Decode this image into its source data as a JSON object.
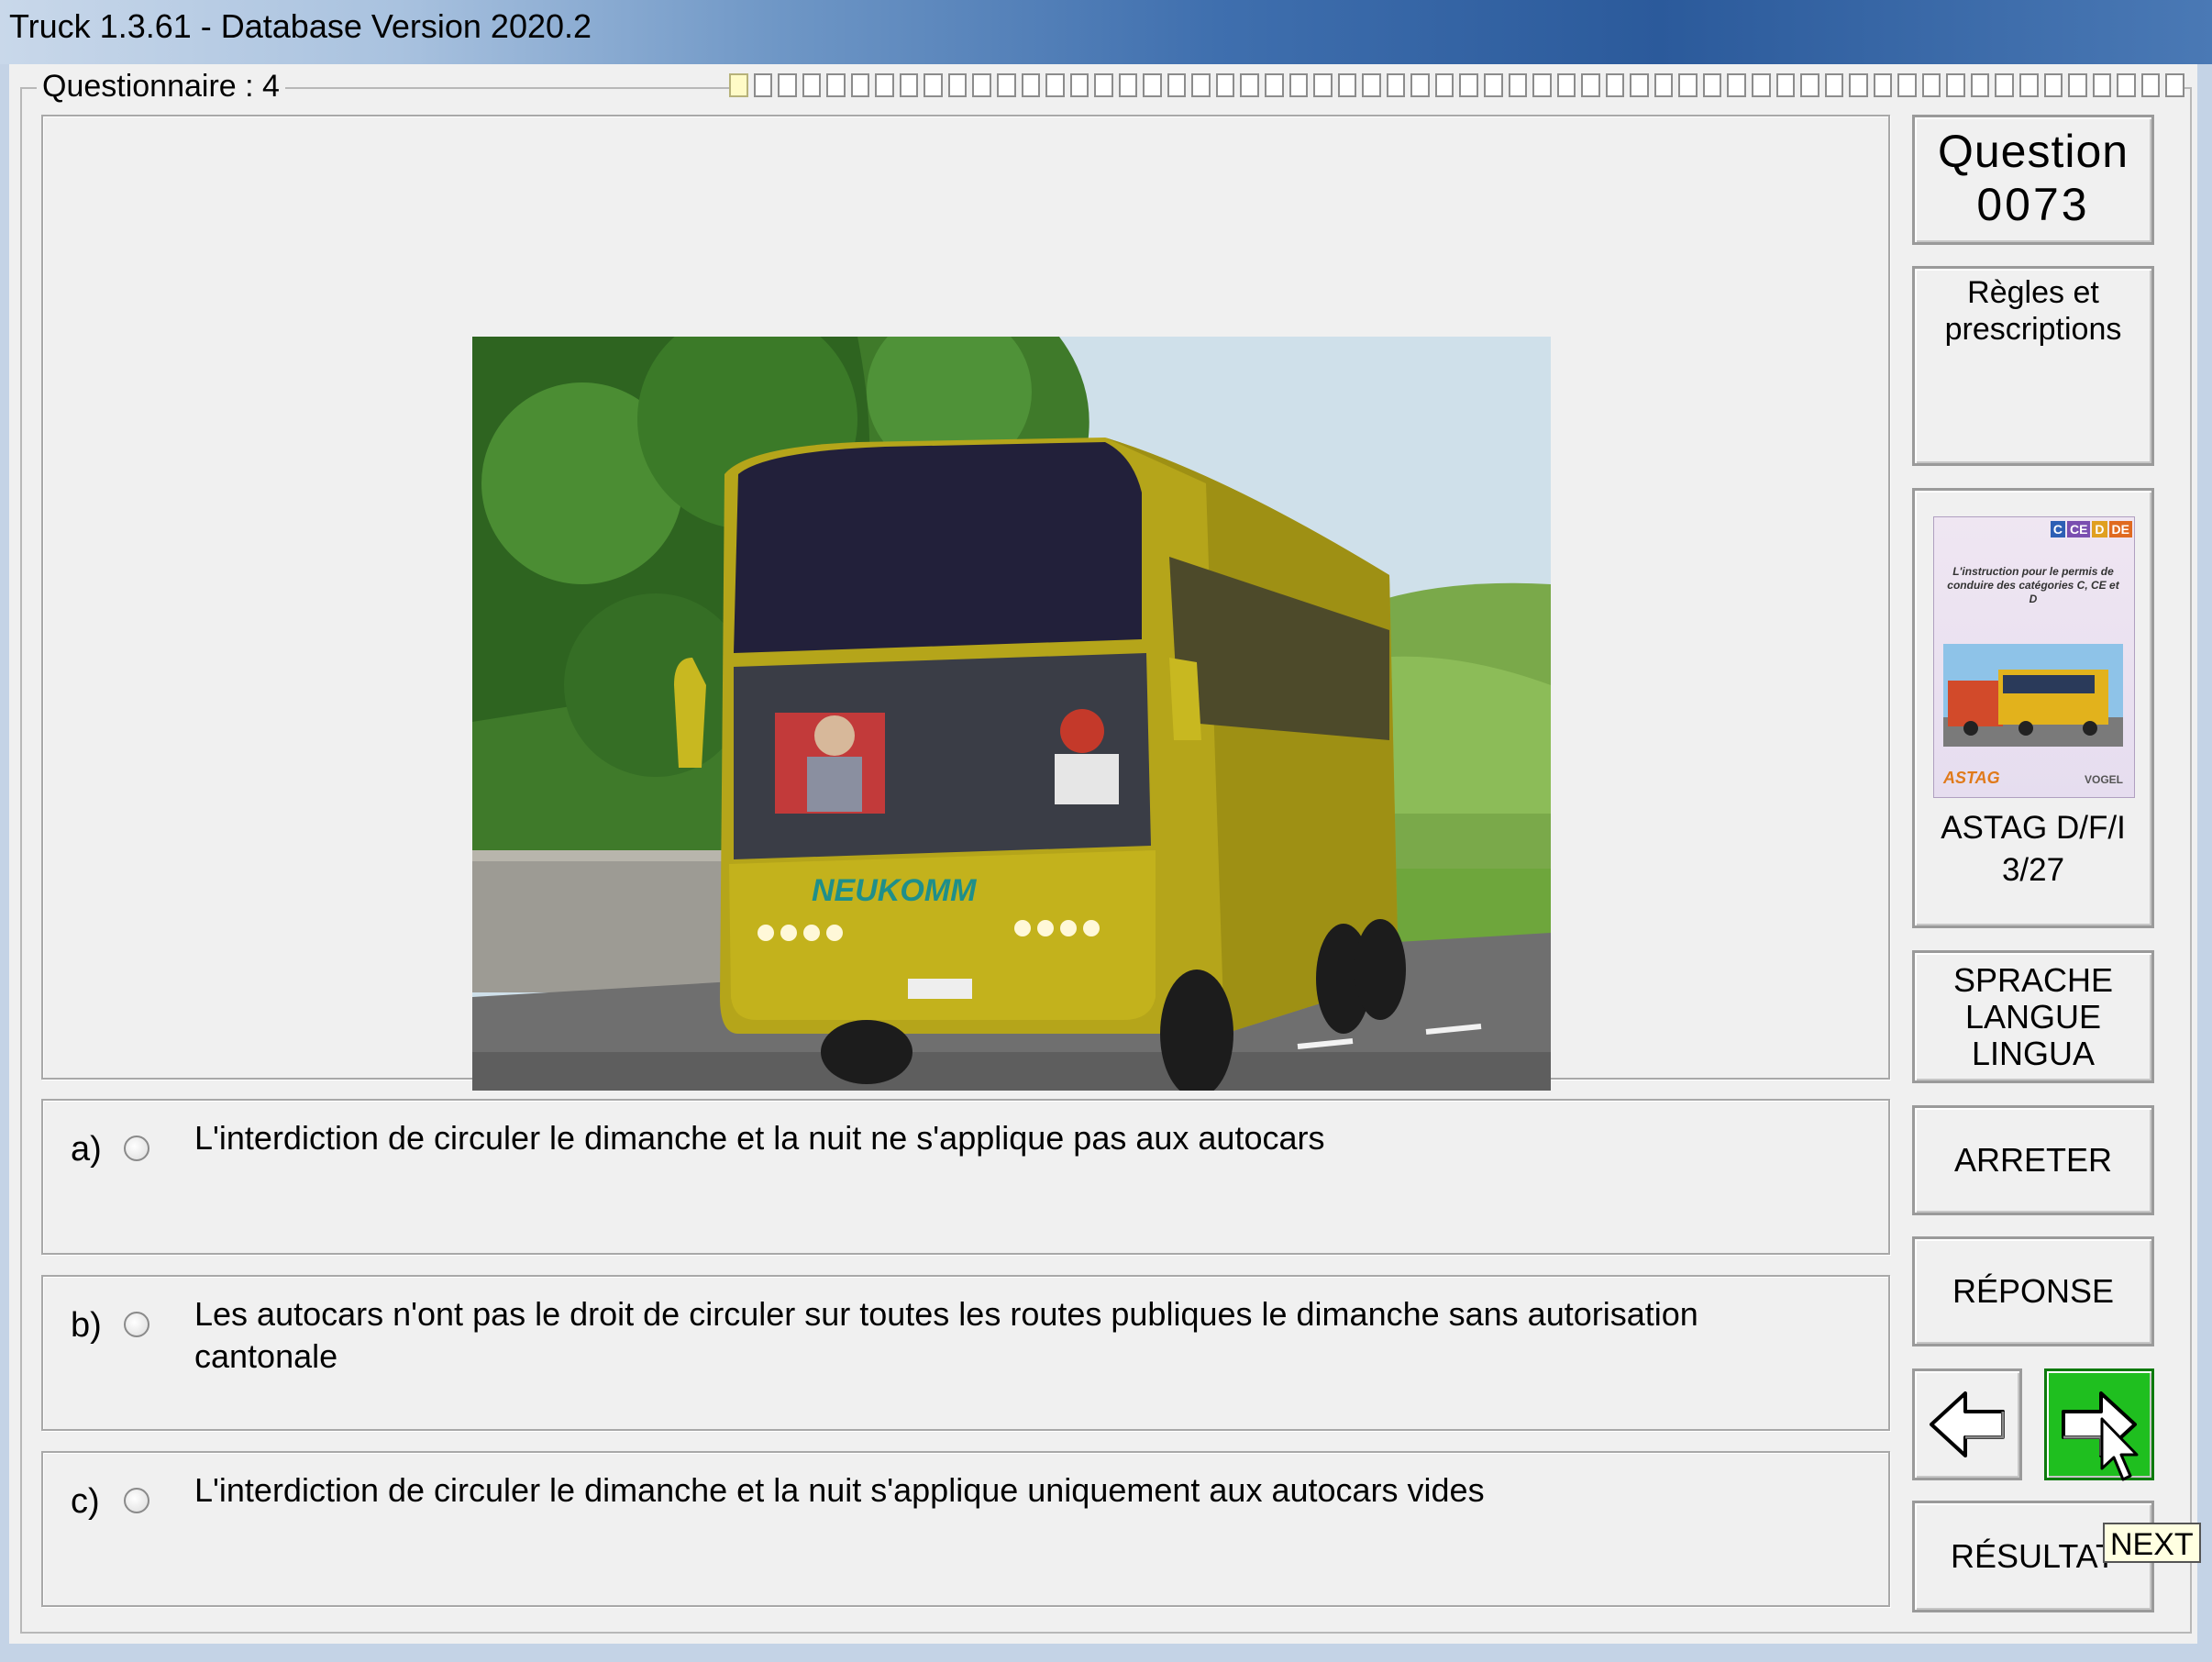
{
  "window": {
    "title": "Truck 1.3.61 - Database Version 2020.2"
  },
  "questionnaire": {
    "label": "Questionnaire : 4",
    "progress": {
      "segments": 60,
      "answered": 1
    }
  },
  "question": {
    "title": "Question",
    "number": "0073",
    "category": "Règles et prescriptions"
  },
  "answers": [
    {
      "letter": "a)",
      "text": "L'interdiction de circuler le dimanche et la nuit ne s'applique pas aux autocars",
      "selected": false
    },
    {
      "letter": "b)",
      "text": "Les autocars n'ont pas le droit de circuler sur toutes les routes publiques le dimanche sans autorisation cantonale",
      "selected": false
    },
    {
      "letter": "c)",
      "text": "L'interdiction de circuler le dimanche et la nuit s'applique uniquement aux autocars vides",
      "selected": false
    }
  ],
  "book": {
    "label_line1": "ASTAG D/F/I",
    "label_line2": "3/27",
    "tags": [
      "C",
      "CE",
      "D",
      "DE"
    ],
    "caption": "L'instruction pour le permis de conduire des catégories C, CE et D",
    "logo_left": "ASTAG",
    "logo_right": "VOGEL"
  },
  "photo": {
    "bus_brand": "NEUKOMM"
  },
  "buttons": {
    "language": [
      "SPRACHE",
      "LANGUE",
      "LINGUA"
    ],
    "stop": "ARRETER",
    "response": "RÉPONSE",
    "results": "RÉSULTAT",
    "previous_icon": "arrow-left-icon",
    "next_icon": "arrow-right-icon"
  },
  "tooltip": "NEXT",
  "colors": {
    "next_button": "#1fbf1f",
    "progress_done": "#fffbc7"
  }
}
